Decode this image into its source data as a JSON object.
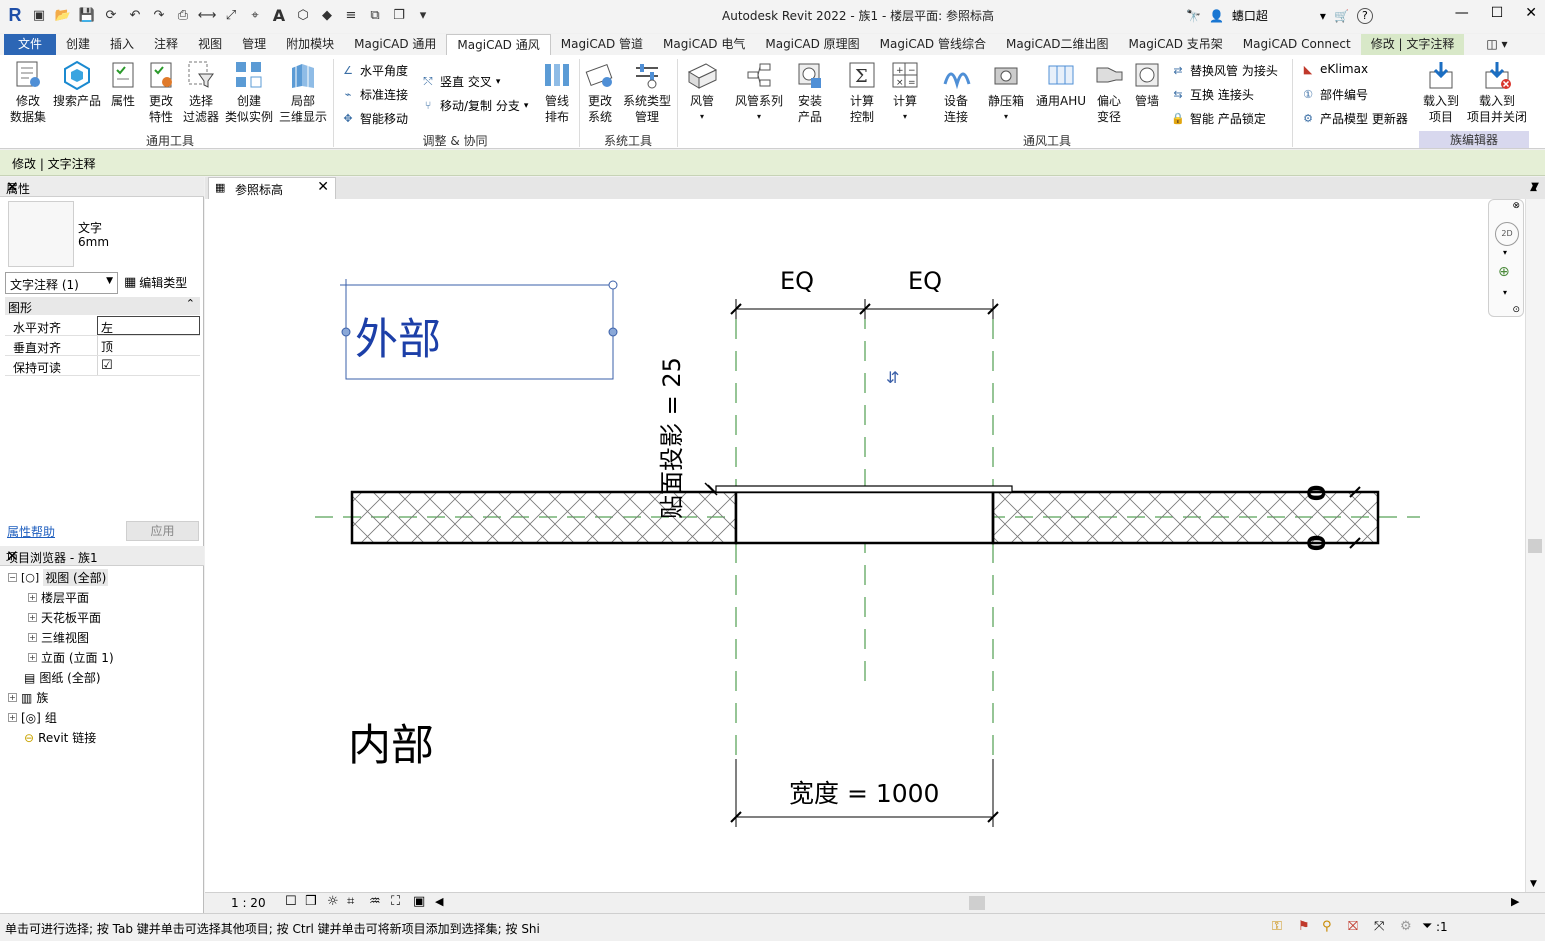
{
  "titlebar": {
    "app_title": "Autodesk Revit 2022 - 族1 - 楼层平面: 参照标高",
    "user": "蟪口超",
    "help": "?"
  },
  "tabs": [
    "文件",
    "创建",
    "插入",
    "注释",
    "视图",
    "管理",
    "附加模块",
    "MagiCAD 通用",
    "MagiCAD 通风",
    "MagiCAD 管道",
    "MagiCAD 电气",
    "MagiCAD 原理图",
    "MagiCAD 管线综合",
    "MagiCAD二维出图",
    "MagiCAD 支吊架",
    "MagiCAD Connect",
    "修改 | 文字注释"
  ],
  "ribbon": {
    "general": {
      "modify_dataset": "修改\n数据集",
      "search_product": "搜索产品",
      "properties": "属性",
      "change_props": "更改\n特性",
      "select_filter": "选择\n过滤器",
      "create_similar": "创建\n类似实例",
      "local_3d": "局部\n三维显示",
      "group": "通用工具"
    },
    "adjust": {
      "horiz_angle": "水平角度",
      "std_connect": "标准连接",
      "smart_move": "智能移动",
      "vertical_cross": "竖直 交叉",
      "move_copy_branch": "移动/复制 分支",
      "pipe_arrange": "管线\n排布",
      "group": "调整 & 协同"
    },
    "system": {
      "change_system": "更改\n系统",
      "system_type_mgmt": "系统类型\n管理",
      "group": "系统工具"
    },
    "vent": {
      "duct": "风管",
      "duct_series": "风管系列",
      "install_product": "安装\n产品",
      "calc_control": "计算\n控制",
      "calc": "计算",
      "device_connect": "设备\n连接",
      "static_box": "静压箱",
      "generic_ahu": "通用AHU",
      "eccentric": "偏心\n变径",
      "pipe_wall": "管墙",
      "replace_duct": "替换风管 为接头",
      "swap_connector": "互换 连接头",
      "smart_lock": "智能 产品锁定",
      "group": "通风工具"
    },
    "misc": {
      "eklimax": "eKlimax",
      "part_number": "部件编号",
      "model_updater": "产品模型 更新器"
    },
    "family_editor": {
      "load_into_project": "载入到\n项目",
      "load_close": "载入到\n项目并关闭",
      "group": "族编辑器"
    }
  },
  "context_bar": "修改 | 文字注释",
  "properties": {
    "title": "属性",
    "type_name": "文字",
    "type_sub": "6mm",
    "selector": "文字注释 (1)",
    "edit_type": "编辑类型",
    "section": "图形",
    "rows": [
      {
        "key": "水平对齐",
        "value": "左"
      },
      {
        "key": "垂直对齐",
        "value": "顶"
      },
      {
        "key": "保持可读",
        "value": "☑"
      }
    ],
    "help": "属性帮助",
    "apply": "应用"
  },
  "browser": {
    "title": "项目浏览器 - 族1",
    "items": [
      {
        "label": "视图 (全部)"
      },
      {
        "label": "楼层平面"
      },
      {
        "label": "天花板平面"
      },
      {
        "label": "三维视图"
      },
      {
        "label": "立面 (立面 1)"
      },
      {
        "label": "图纸 (全部)"
      },
      {
        "label": "族"
      },
      {
        "label": "组"
      },
      {
        "label": "Revit 链接"
      }
    ]
  },
  "view_tab": "参照标高",
  "drawing": {
    "outside_label": "外部",
    "inside_label": "内部",
    "eq_left": "EQ",
    "eq_right": "EQ",
    "face_projection": "贴面投影 = 25",
    "width_label": "宽度 = 1000",
    "zero_top": "0",
    "zero_bottom": "0"
  },
  "view_bottom": {
    "scale": "1 : 20"
  },
  "status": {
    "message": "单击可进行选择; 按 Tab 键并单击可选择其他项目; 按 Ctrl 键并单击可将新项目添加到选择集; 按 Shi",
    "filter_count": ":1"
  }
}
